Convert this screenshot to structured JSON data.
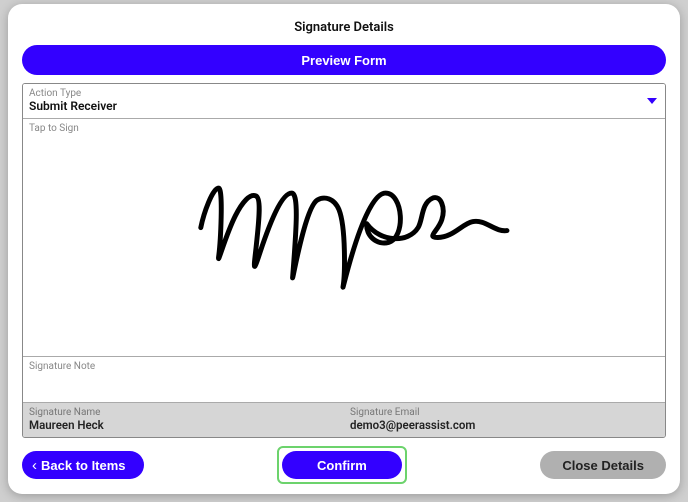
{
  "modal": {
    "title": "Signature Details",
    "preview_label": "Preview Form"
  },
  "action": {
    "label": "Action Type",
    "value": "Submit Receiver"
  },
  "signature": {
    "tap_label": "Tap to Sign"
  },
  "note": {
    "label": "Signature Note",
    "value": ""
  },
  "signer": {
    "name_label": "Signature Name",
    "name_value": "Maureen Heck",
    "email_label": "Signature Email",
    "email_value": "demo3@peerassist.com"
  },
  "buttons": {
    "back": "Back to Items",
    "confirm": "Confirm",
    "close": "Close Details"
  }
}
